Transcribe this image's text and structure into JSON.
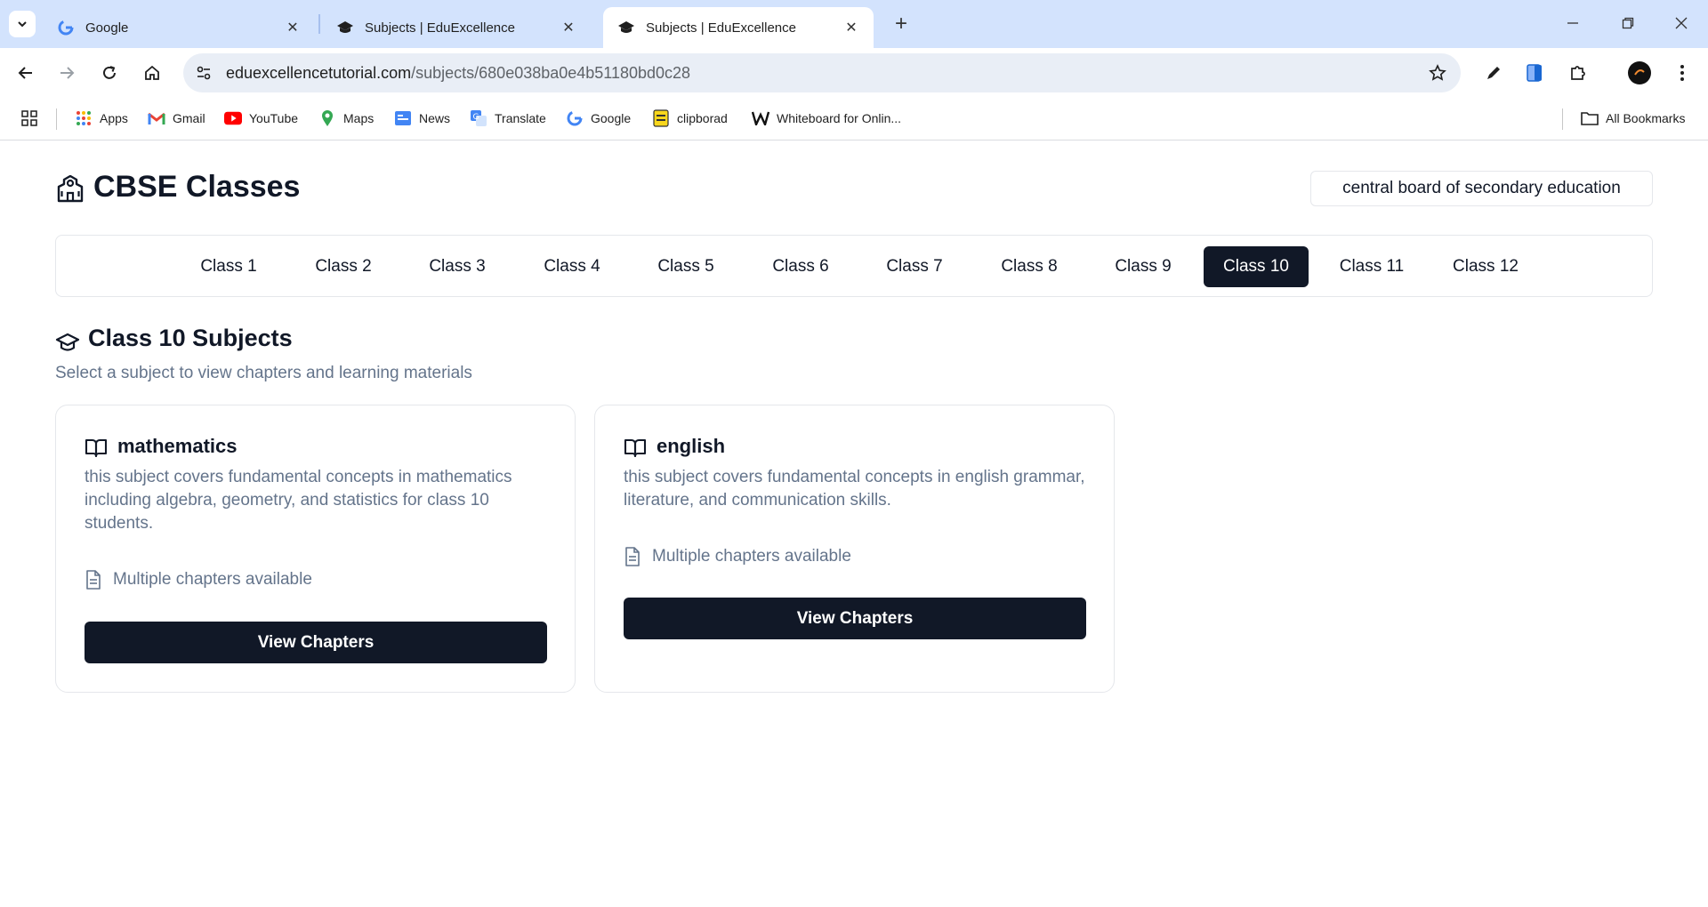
{
  "browser": {
    "tabs": [
      {
        "title": "Google",
        "active": false
      },
      {
        "title": "Subjects | EduExcellence",
        "active": false
      },
      {
        "title": "Subjects | EduExcellence",
        "active": true
      }
    ],
    "url_host": "eduexcellencetutorial.com",
    "url_path": "/subjects/680e038ba0e4b51180bd0c28",
    "bookmarks": [
      "Apps",
      "Gmail",
      "YouTube",
      "Maps",
      "News",
      "Translate",
      "Google",
      "clipborad",
      "Whiteboard for Onlin..."
    ],
    "all_bookmarks": "All Bookmarks"
  },
  "header": {
    "title": "CBSE Classes",
    "board_badge": "central board of secondary education"
  },
  "classes": [
    "Class 1",
    "Class 2",
    "Class 3",
    "Class 4",
    "Class 5",
    "Class 6",
    "Class 7",
    "Class 8",
    "Class 9",
    "Class 10",
    "Class 11",
    "Class 12"
  ],
  "selected_class": "Class 10",
  "section": {
    "title": "Class 10 Subjects",
    "subtitle": "Select a subject to view chapters and learning materials"
  },
  "subjects": [
    {
      "name": "mathematics",
      "description": "this subject covers fundamental concepts in mathematics including algebra, geometry, and statistics for class 10 students.",
      "meta": "Multiple chapters available",
      "button": "View Chapters"
    },
    {
      "name": "english",
      "description": "this subject covers fundamental concepts in english grammar, literature, and communication skills.",
      "meta": "Multiple chapters available",
      "button": "View Chapters"
    }
  ],
  "colors": {
    "primary": "#111827",
    "muted_text": "#64748b",
    "border": "#e5e7eb",
    "chrome_tabstrip": "#d3e3fd"
  }
}
